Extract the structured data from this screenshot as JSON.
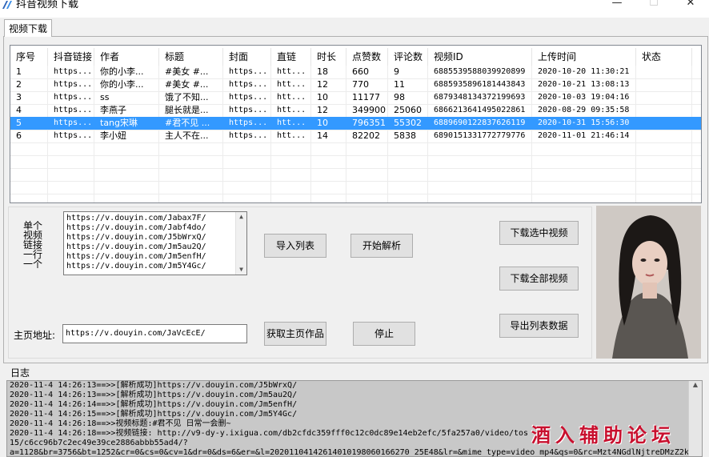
{
  "window": {
    "title": "抖音视频下载",
    "minimize": "—",
    "maximize": "☐",
    "close": "✕"
  },
  "tabs": [
    {
      "label": "视频下载"
    }
  ],
  "table": {
    "columns": [
      "序号",
      "抖音链接",
      "作者",
      "标题",
      "封面",
      "直链",
      "时长",
      "点赞数",
      "评论数",
      "视频ID",
      "上传时间",
      "状态"
    ],
    "rows": [
      [
        "1",
        "https...",
        "你的小李...",
        "#美女 #...",
        "https...",
        "htt...",
        "18",
        "660",
        "9",
        "6885539588039920899",
        "2020-10-20 11:30:21",
        ""
      ],
      [
        "2",
        "https...",
        "你的小李...",
        "#美女 #...",
        "https...",
        "htt...",
        "12",
        "770",
        "11",
        "6885935896181443843",
        "2020-10-21 13:08:13",
        ""
      ],
      [
        "3",
        "https...",
        "ss",
        "饿了不知...",
        "https...",
        "htt...",
        "10",
        "11177",
        "98",
        "6879348134372199693",
        "2020-10-03 19:04:16",
        ""
      ],
      [
        "4",
        "https...",
        "李燕子",
        "腿长就是...",
        "https...",
        "htt...",
        "12",
        "349900",
        "25060",
        "6866213641495022861",
        "2020-08-29 09:35:58",
        ""
      ],
      [
        "5",
        "https...",
        "tang宋琳",
        "#君不见 ...",
        "https...",
        "htt...",
        "10",
        "796351",
        "55302",
        "6889690122837626119",
        "2020-10-31 15:56:30",
        ""
      ],
      [
        "6",
        "https...",
        "李小妞",
        "主人不在...",
        "https...",
        "htt...",
        "14",
        "82202",
        "5838",
        "6890151331772779776",
        "2020-11-01 21:46:14",
        ""
      ]
    ],
    "selected_index": 4
  },
  "links_label": "单个视频链接一行一个",
  "links_text": [
    "https://v.douyin.com/Jabax7F/",
    "https://v.douyin.com/Jabf4do/",
    "https://v.douyin.com/J5bWrxQ/",
    "https://v.douyin.com/Jm5au2Q/",
    "https://v.douyin.com/Jm5enfH/",
    "https://v.douyin.com/Jm5Y4Gc/"
  ],
  "buttons": {
    "import_list": "导入列表",
    "start_parse": "开始解析",
    "download_selected": "下载选中视频",
    "download_all": "下载全部视频",
    "export_list": "导出列表数据",
    "fetch_homepage": "获取主页作品",
    "stop": "停止"
  },
  "homepage": {
    "label": "主页地址:",
    "value": "https://v.douyin.com/JaVcEcE/"
  },
  "log": {
    "label": "日志",
    "lines": [
      "2020-11-4 14:26:13==>>[解析成功]https://v.douyin.com/J5bWrxQ/",
      "2020-11-4 14:26:13==>>[解析成功]https://v.douyin.com/Jm5au2Q/",
      "2020-11-4 14:26:14==>>[解析成功]https://v.douyin.com/Jm5enfH/",
      "2020-11-4 14:26:15==>>[解析成功]https://v.douyin.com/Jm5Y4Gc/",
      "2020-11-4 14:26:18==>>视频标题:#君不见  日常一会删~",
      "2020-11-4 14:26:18==>>视频链接: http://v9-dy-y.ixigua.com/db2cfdc359fff0c12c0dc89e14eb2efc/5fa257a0/video/tos",
      "15/c6cc96b7c2ec49e39ce2886abbb55ad4/?",
      "a=1128&br=3756&bt=1252&cr=0&cs=0&cv=1&dr=0&ds=6&er=&l=20201104142614010198060166270 25E48&lr=&mime_type=video_mp4&qs=0&rc=Mzt4NGdlNjtreDMzZ2k"
    ]
  },
  "watermark": "酒入辅助论坛",
  "colors": {
    "selection": "#3399ff",
    "watermark": "#c8102e"
  }
}
